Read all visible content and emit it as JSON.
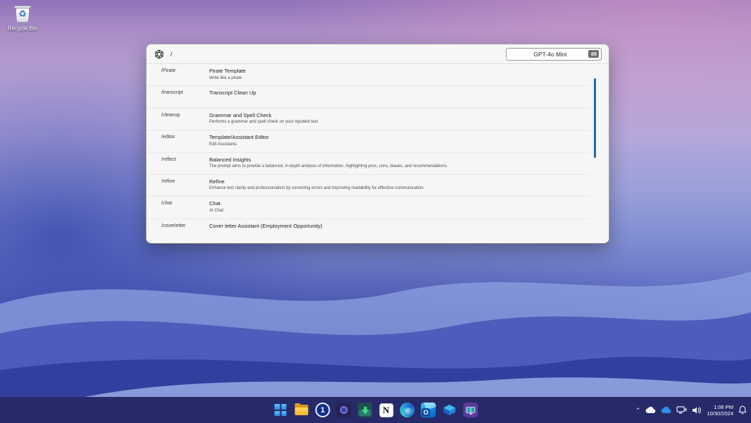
{
  "desktop": {
    "recycle_bin_label": "Recycle Bin",
    "recycle_glyph": "♻"
  },
  "window": {
    "query": "/",
    "model_selector": {
      "label": "GPT-4o Mini"
    },
    "commands": [
      {
        "command": "/Pirate",
        "title": "Pirate Template",
        "description": "Write like a pirate"
      },
      {
        "command": "/transcript",
        "title": "Transcript Clean Up",
        "description": ""
      },
      {
        "command": "/cleanup",
        "title": "Grammar and Spell Check",
        "description": "Performs a grammar and spell check on your inputted text"
      },
      {
        "command": "/editor",
        "title": "Template/Assistant Editor",
        "description": "Edit Assistants"
      },
      {
        "command": "/reflect",
        "title": "Balanced Insights",
        "description": "The prompt aims to provide a balanced, in-depth analysis of information, highlighting pros, cons, biases, and recommendations."
      },
      {
        "command": "/refine",
        "title": "Refine",
        "description": "Enhance text clarity and professionalism by correcting errors and improving readability for effective communication."
      },
      {
        "command": "/chat",
        "title": "Chat",
        "description": "AI Chat"
      },
      {
        "command": "/coverletter",
        "title": "Cover letter Assistant (Employment Opportunity)",
        "description": ""
      }
    ]
  },
  "taskbar": {
    "icons": [
      "start-icon",
      "file-explorer-icon",
      "1password-icon",
      "purple-ring-app-icon",
      "downloads-app-icon",
      "notion-icon",
      "edge-icon",
      "outlook-icon",
      "blue-cube-app-icon",
      "monitor-app-icon"
    ],
    "icon_glyphs": {
      "onepassword": "1",
      "notion": "N",
      "outlook": "O"
    },
    "tray_icons": [
      "chevron-up-icon",
      "cloud-icon",
      "onedrive-cloud-icon",
      "network-icon",
      "volume-icon",
      "bell-icon"
    ],
    "clock": {
      "time": "1:06 PM",
      "date": "10/30/2024"
    }
  },
  "colors": {
    "taskbar": "#272a68",
    "scrollbar_accent": "#1b6ca8",
    "window_background": "#f6f6f6",
    "selector_badge": "#6f6f6f"
  }
}
